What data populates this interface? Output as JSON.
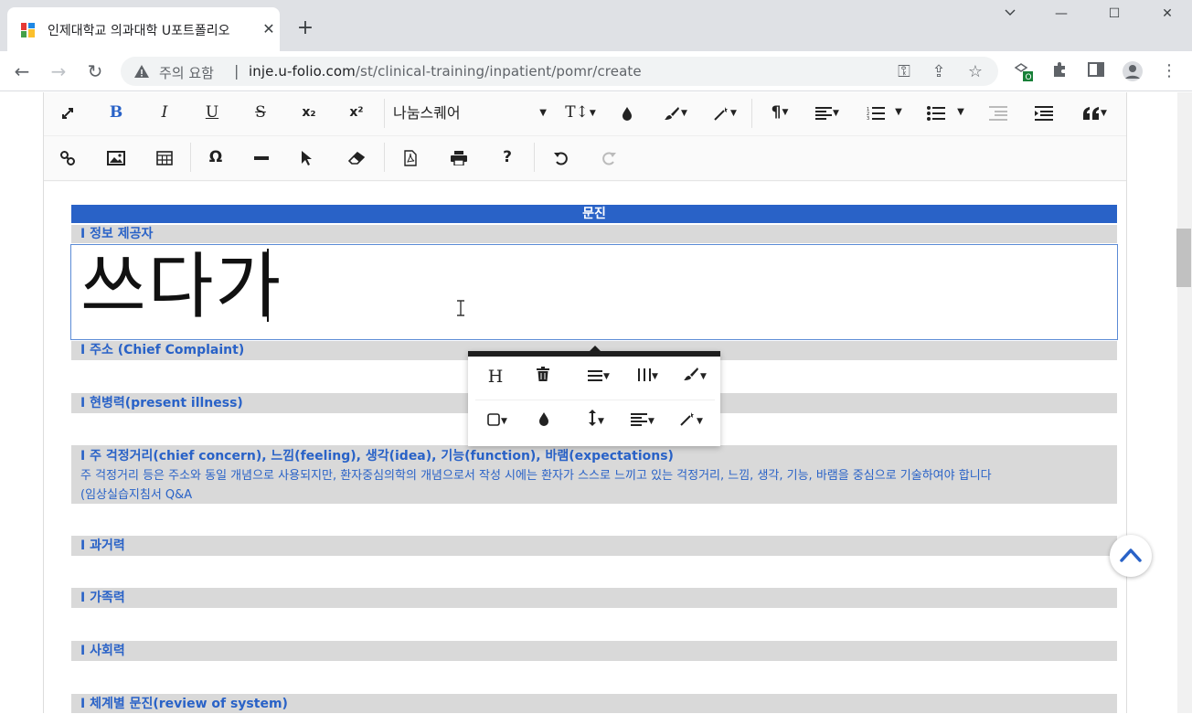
{
  "browser": {
    "tab_title": "인제대학교 의과대학 U포트폴리오",
    "tab_close": "✕",
    "new_tab": "+",
    "window_controls": [
      "—",
      "☐",
      "✕"
    ],
    "not_secure_label": "주의 요함",
    "separator": "|",
    "url_host": "inje.u-folio.com",
    "url_path": "/st/clinical-training/inpatient/pomr/create"
  },
  "toolbar": {
    "font_name": "나눔스퀘어",
    "bold": "B",
    "italic": "I",
    "underline": "U",
    "strike": "S",
    "subscript": "x₂",
    "superscript": "x²",
    "font_size": "T↕",
    "omega": "Ω",
    "help": "?",
    "paragraph": "¶"
  },
  "form": {
    "header": "문진",
    "sections": [
      {
        "label": "I 정보 제공자",
        "value": "쓰다가"
      },
      {
        "label": "I 주소 (Chief Complaint)"
      },
      {
        "label": "I 현병력(present illness)"
      },
      {
        "label": "I 주 걱정거리(chief concern), 느낌(feeling), 생각(idea), 기능(function), 바램(expectations)",
        "note_line1": "주 걱정거리 등은 주소와 동일 개념으로 사용되지만, 환자중심의학의 개념으로서 작성 시에는 환자가 스스로 느끼고 있는 걱정거리, 느낌, 생각, 기능, 바램을 중심으로 기술하여야 합니다",
        "note_line2": "(임상실습지침서 Q&A"
      },
      {
        "label": "I 과거력"
      },
      {
        "label": "I 가족력"
      },
      {
        "label": "I 사회력"
      },
      {
        "label": "I 체계별 문진(review of system)"
      }
    ]
  },
  "popup": {
    "heading_btn": "H"
  },
  "colors": {
    "accent": "#2962c7",
    "section_bg": "#d9d9d9"
  }
}
